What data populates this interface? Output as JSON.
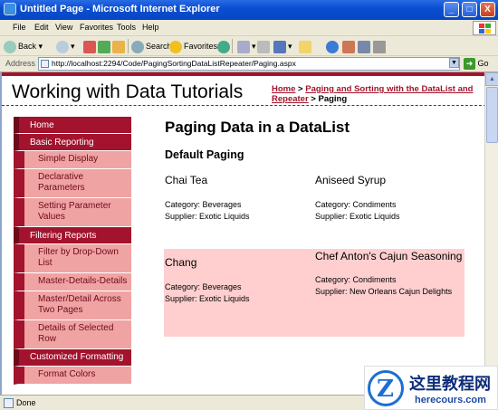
{
  "window": {
    "title": "Untitled Page - Microsoft Internet Explorer",
    "buttons": [
      "_",
      "□",
      "X"
    ]
  },
  "menubar": {
    "items": [
      "File",
      "Edit",
      "View",
      "Favorites",
      "Tools",
      "Help"
    ]
  },
  "toolbar": {
    "back": "Back",
    "search": "Search",
    "favorites": "Favorites"
  },
  "addressbar": {
    "label": "Address",
    "url": "http://localhost:2294/Code/PagingSortingDataListRepeater/Paging.aspx",
    "go": "Go"
  },
  "site": {
    "title": "Working with Data Tutorials",
    "breadcrumb": {
      "home": "Home",
      "sep1": " > ",
      "section": "Paging and Sorting with the DataList and Repeater",
      "sep2": " > ",
      "current": "Paging"
    }
  },
  "sidebar": {
    "items": [
      {
        "label": "Home",
        "level": "top"
      },
      {
        "label": "Basic Reporting",
        "level": "top"
      },
      {
        "label": "Simple Display",
        "level": "sub"
      },
      {
        "label": "Declarative Parameters",
        "level": "sub"
      },
      {
        "label": "Setting Parameter Values",
        "level": "sub"
      },
      {
        "label": "Filtering Reports",
        "level": "top"
      },
      {
        "label": "Filter by Drop-Down List",
        "level": "sub"
      },
      {
        "label": "Master-Details-Details",
        "level": "sub"
      },
      {
        "label": "Master/Detail Across Two Pages",
        "level": "sub"
      },
      {
        "label": "Details of Selected Row",
        "level": "sub"
      },
      {
        "label": "Customized Formatting",
        "level": "top"
      },
      {
        "label": "Format Colors",
        "level": "sub"
      }
    ]
  },
  "main": {
    "heading": "Paging Data in a DataList",
    "subheading": "Default Paging",
    "products": [
      {
        "name": "Chai Tea",
        "category": "Category: Beverages",
        "supplier": "Supplier: Exotic Liquids"
      },
      {
        "name": "Aniseed Syrup",
        "category": "Category: Condiments",
        "supplier": "Supplier: Exotic Liquids"
      },
      {
        "name": "Chang",
        "category": "Category: Beverages",
        "supplier": "Supplier: Exotic Liquids"
      },
      {
        "name": "Chef Anton's Cajun Seasoning",
        "category": "Category: Condiments",
        "supplier": "Supplier: New Orleans Cajun Delights"
      }
    ]
  },
  "status": {
    "text": "Done"
  },
  "watermark": {
    "line1": "这里教程网",
    "line2": "herecours.com"
  },
  "colors": {
    "accent": "#a3132d",
    "menu_light": "#f0a3a3",
    "row_alt": "#ffcfcf",
    "titlebar": "#0a4fd1"
  }
}
